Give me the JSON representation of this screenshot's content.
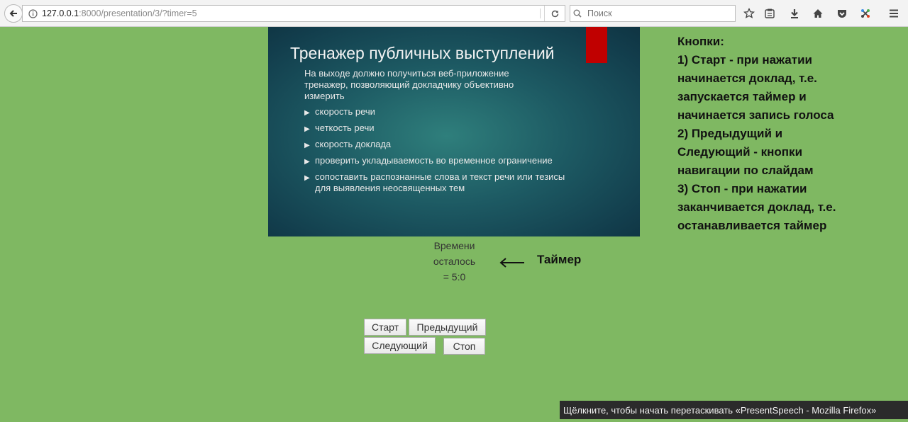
{
  "browser": {
    "url_host": "127.0.0.1",
    "url_rest": ":8000/presentation/3/?timer=5",
    "search_placeholder": "Поиск"
  },
  "slide": {
    "title": "Тренажер публичных выступлений",
    "intro": "На выходе должно получиться веб-приложение тренажер, позволяющий докладчику объективно измерить",
    "bullets": [
      "скорость речи",
      "четкость речи",
      "скорость доклада",
      "проверить укладываемость во временное ограничение",
      "сопоставить распознанные слова и текст речи или тезисы для выявления неосвященных тем"
    ]
  },
  "timer": {
    "line1": "Времени",
    "line2": "осталось",
    "line3": "= 5:0",
    "annotation": "Таймер"
  },
  "notes": {
    "lines": [
      "Кнопки:",
      "1) Старт - при нажатии",
      "начинается доклад, т.е.",
      "запускается таймер и",
      "начинается запись голоса",
      "2) Предыдущий и",
      "Следующий - кнопки",
      "навигации по слайдам",
      "3) Стоп - при нажатии",
      "заканчивается доклад, т.е.",
      "останавливается таймер"
    ]
  },
  "buttons": {
    "start": "Старт",
    "prev": "Предыдущий",
    "next": "Следующий",
    "stop": "Стоп"
  },
  "tooltip": "Щёлкните, чтобы начать перетаскивать «PresentSpeech - Mozilla Firefox»",
  "colors": {
    "page_bg": "#7fb862",
    "slide_accent": "#c00000",
    "slide_bg": "#1d5a63"
  }
}
